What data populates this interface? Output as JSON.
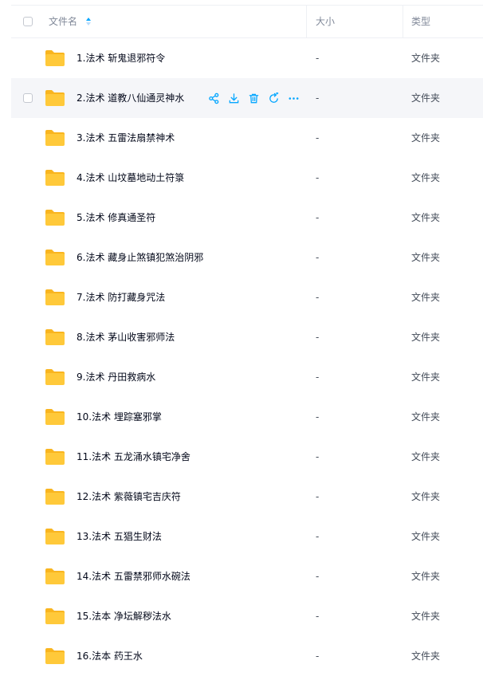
{
  "header": {
    "name_label": "文件名",
    "size_label": "大小",
    "type_label": "类型"
  },
  "colors": {
    "accent": "#06a7ff",
    "folder": "#ffc93a",
    "folder_back": "#f9b51f"
  },
  "hover_row_index": 1,
  "hover_actions": [
    "share-icon",
    "download-icon",
    "delete-icon",
    "restore-icon",
    "more-icon"
  ],
  "files": [
    {
      "name": "1.法术 斩鬼退邪符令",
      "size": "-",
      "type": "文件夹"
    },
    {
      "name": "2.法术 道教八仙通灵神水",
      "size": "-",
      "type": "文件夹"
    },
    {
      "name": "3.法术 五雷法扇禁神术",
      "size": "-",
      "type": "文件夹"
    },
    {
      "name": "4.法术 山坟墓地动土符箓",
      "size": "-",
      "type": "文件夹"
    },
    {
      "name": "5.法术 修真通圣符",
      "size": "-",
      "type": "文件夹"
    },
    {
      "name": "6.法术 藏身止煞镇犯煞治阴邪",
      "size": "-",
      "type": "文件夹"
    },
    {
      "name": "7.法术 防打藏身咒法",
      "size": "-",
      "type": "文件夹"
    },
    {
      "name": "8.法术 茅山收害邪师法",
      "size": "-",
      "type": "文件夹"
    },
    {
      "name": "9.法术 丹田救病水",
      "size": "-",
      "type": "文件夹"
    },
    {
      "name": "10.法术 埋踪塞邪掌",
      "size": "-",
      "type": "文件夹"
    },
    {
      "name": "11.法术 五龙涌水镇宅净舍",
      "size": "-",
      "type": "文件夹"
    },
    {
      "name": "12.法术 紫薇镇宅吉庆符",
      "size": "-",
      "type": "文件夹"
    },
    {
      "name": "13.法术 五猖生财法",
      "size": "-",
      "type": "文件夹"
    },
    {
      "name": "14.法术 五雷禁邪师水碗法",
      "size": "-",
      "type": "文件夹"
    },
    {
      "name": "15.法本 净坛解秽法水",
      "size": "-",
      "type": "文件夹"
    },
    {
      "name": "16.法本 药王水",
      "size": "-",
      "type": "文件夹"
    }
  ]
}
